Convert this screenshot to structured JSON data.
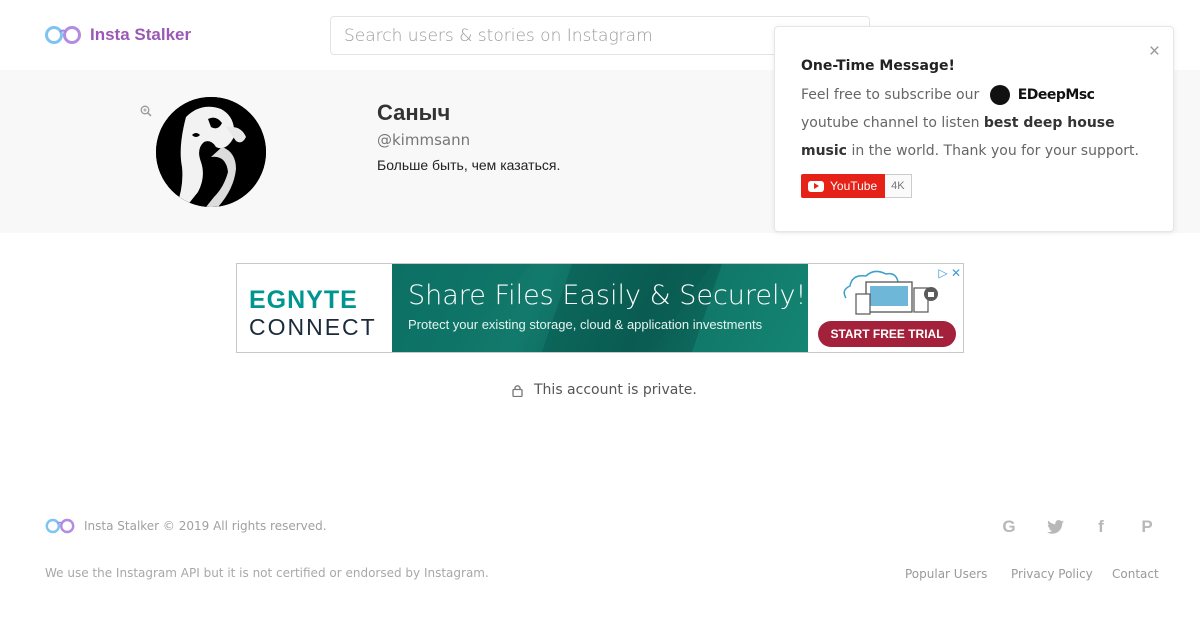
{
  "header": {
    "brand": "Insta Stalker",
    "search_placeholder": "Search users & stories on Instagram"
  },
  "profile": {
    "name": "Саныч",
    "handle": "@kimmsann",
    "bio": "Больше быть, чем казаться."
  },
  "popup": {
    "title": "One-Time Message!",
    "text_before": "Feel free to subscribe our",
    "channel_name": "EDeepMsc",
    "text_after_1": "youtube channel to listen",
    "bold_text": "best deep house music",
    "text_after_2": "in the world. Thank you for your support.",
    "youtube_label": "YouTube",
    "subscriber_count": "4K",
    "close_label": "×"
  },
  "ad": {
    "brand_line1": "EGNYTE",
    "brand_line2": "CONNECT",
    "headline": "Share Files Easily & Securely!",
    "subline": "Protect your existing storage, cloud & application investments",
    "cta": "START FREE TRIAL",
    "choices": "▷ ✕"
  },
  "main": {
    "private_message": "This account is private."
  },
  "footer": {
    "copyright": "Insta Stalker © 2019 All rights reserved.",
    "disclaimer": "We use the Instagram API but it is not certified or endorsed by Instagram.",
    "social": {
      "google": "G",
      "facebook": "f",
      "pinterest": "P"
    },
    "links": [
      "Popular Users",
      "Privacy Policy",
      "Contact"
    ]
  },
  "colors": {
    "brand": "#9b59b6",
    "youtube_red": "#e62117",
    "ad_green": "#0c6b5f",
    "ad_cta": "#a3213a"
  }
}
